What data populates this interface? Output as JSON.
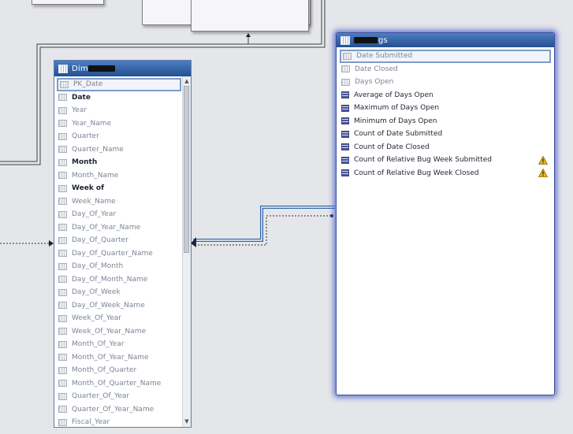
{
  "dimension_table": {
    "title_visible": "Dim",
    "fields": [
      {
        "label": "PK_Date",
        "weight": "light",
        "selected": true
      },
      {
        "label": "Date",
        "weight": "bold"
      },
      {
        "label": "Year",
        "weight": "light"
      },
      {
        "label": "Year_Name",
        "weight": "light"
      },
      {
        "label": "Quarter",
        "weight": "light"
      },
      {
        "label": "Quarter_Name",
        "weight": "light"
      },
      {
        "label": "Month",
        "weight": "bold"
      },
      {
        "label": "Month_Name",
        "weight": "light"
      },
      {
        "label": "Week of",
        "weight": "bold"
      },
      {
        "label": "Week_Name",
        "weight": "light"
      },
      {
        "label": "Day_Of_Year",
        "weight": "light"
      },
      {
        "label": "Day_Of_Year_Name",
        "weight": "light"
      },
      {
        "label": "Day_Of_Quarter",
        "weight": "light"
      },
      {
        "label": "Day_Of_Quarter_Name",
        "weight": "light"
      },
      {
        "label": "Day_Of_Month",
        "weight": "light"
      },
      {
        "label": "Day_Of_Month_Name",
        "weight": "light"
      },
      {
        "label": "Day_Of_Week",
        "weight": "light"
      },
      {
        "label": "Day_Of_Week_Name",
        "weight": "light"
      },
      {
        "label": "Week_Of_Year",
        "weight": "light"
      },
      {
        "label": "Week_Of_Year_Name",
        "weight": "light"
      },
      {
        "label": "Month_Of_Year",
        "weight": "light"
      },
      {
        "label": "Month_Of_Year_Name",
        "weight": "light"
      },
      {
        "label": "Month_Of_Quarter",
        "weight": "light"
      },
      {
        "label": "Month_Of_Quarter_Name",
        "weight": "light"
      },
      {
        "label": "Quarter_Of_Year",
        "weight": "light"
      },
      {
        "label": "Quarter_Of_Year_Name",
        "weight": "light"
      },
      {
        "label": "Fiscal_Year",
        "weight": "light"
      }
    ]
  },
  "fact_table": {
    "title_visible": "gs",
    "fields": [
      {
        "label": "Date Submitted",
        "kind": "attribute",
        "selected": true
      },
      {
        "label": "Date Closed",
        "kind": "attribute"
      },
      {
        "label": "Days Open",
        "kind": "attribute"
      },
      {
        "label": "Average of Days Open",
        "kind": "measure"
      },
      {
        "label": "Maximum of Days Open",
        "kind": "measure"
      },
      {
        "label": "Minimum of Days Open",
        "kind": "measure"
      },
      {
        "label": "Count of Date Submitted",
        "kind": "measure"
      },
      {
        "label": "Count of Date Closed",
        "kind": "measure"
      },
      {
        "label": "Count of Relative Bug Week Submitted",
        "kind": "measure",
        "warning": true
      },
      {
        "label": "Count of Relative Bug Week Closed",
        "kind": "measure",
        "warning": true
      }
    ]
  },
  "icons": {
    "table": "table-grid-icon",
    "attribute": "column-icon",
    "measure": "measure-icon",
    "warning": "warning-triangle-icon",
    "scroll_up": "chevron-up-icon",
    "scroll_down": "chevron-down-icon"
  },
  "colors": {
    "canvas": "#e4e6ea",
    "header": "#2f5ea6",
    "selection": "#7d9bc9",
    "glow": "#4a5ac8",
    "warning": "#e8b51a",
    "relationship_line": "#2d63a6"
  }
}
